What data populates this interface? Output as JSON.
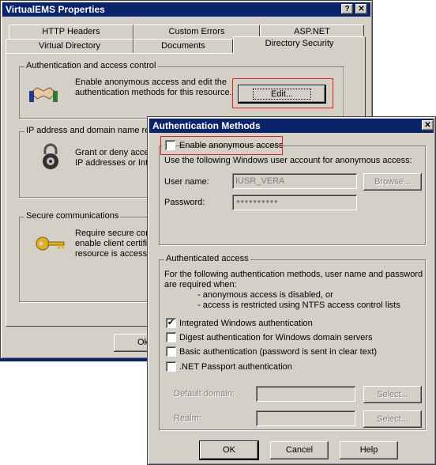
{
  "props": {
    "title": "VirtualEMS Properties",
    "help_btn": "?",
    "close_btn": "✕",
    "tabs_back": [
      "HTTP Headers",
      "Custom Errors",
      "ASP.NET"
    ],
    "tabs_front": [
      "Virtual Directory",
      "Documents",
      "Directory Security"
    ],
    "auth_group": "Authentication and access control",
    "auth_desc_1": "Enable anonymous access and edit the",
    "auth_desc_2": "authentication methods for this resource.",
    "edit_btn": "Edit...",
    "ip_group": "IP address and domain name res",
    "ip_desc_1": "Grant or deny acce",
    "ip_desc_2": "IP addresses or Int",
    "secure_group": "Secure communications",
    "secure_desc_1": "Require secure con",
    "secure_desc_2": "enable client certifi",
    "secure_desc_3": "resource is accesse",
    "ok_btn": "Ok"
  },
  "auth": {
    "title": "Authentication Methods",
    "close_btn": "✕",
    "anon_label": "Enable anonymous access",
    "anon_checked": false,
    "use_account": "Use the following Windows user account for anonymous access:",
    "username_label": "User name:",
    "username_value": "IUSR_VERA",
    "browse_btn": "Browse...",
    "password_label": "Password:",
    "password_value": "●●●●●●●●●●",
    "authenticated_group": "Authenticated access",
    "auth_desc_1": "For the following authentication methods, user name and password",
    "auth_desc_2": "are required when:",
    "auth_desc_3": "- anonymous access is disabled, or",
    "auth_desc_4": "- access is restricted using NTFS access control lists",
    "methods": [
      {
        "label": "Integrated Windows authentication",
        "checked": true
      },
      {
        "label": "Digest authentication for Windows domain servers",
        "checked": false
      },
      {
        "label": "Basic authentication (password is sent in clear text)",
        "checked": false
      },
      {
        "label": ".NET Passport authentication",
        "checked": false
      }
    ],
    "default_domain_label": "Default domain:",
    "realm_label": "Realm:",
    "select_btn": "Select...",
    "ok_btn": "OK",
    "cancel_btn": "Cancel",
    "help_btn": "Help",
    "check_mark": "✔"
  }
}
